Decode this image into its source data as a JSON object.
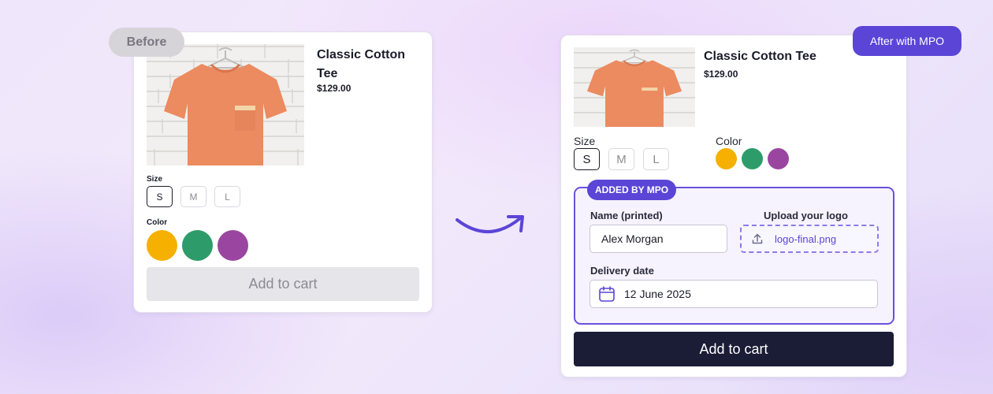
{
  "before": {
    "badge": "Before",
    "title": "Classic Cotton Tee",
    "price": "$129.00",
    "size_label": "Size",
    "sizes": [
      "S",
      "M",
      "L"
    ],
    "selected_size": "S",
    "color_label": "Color",
    "colors": [
      "#f5b000",
      "#2e9c6a",
      "#9a46a0"
    ],
    "cart_label": "Add to cart"
  },
  "after": {
    "badge": "After with MPO",
    "title": "Classic Cotton Tee",
    "price": "$129.00",
    "size_label": "Size",
    "sizes": [
      "S",
      "M",
      "L"
    ],
    "selected_size": "S",
    "color_label": "Color",
    "colors": [
      "#f5b000",
      "#2e9c6a",
      "#9a46a0"
    ],
    "mpo_tag": "ADDED BY MPO",
    "name_label": "Name (printed)",
    "name_value": "Alex Morgan",
    "upload_label": "Upload your logo",
    "upload_file": "logo-final.png",
    "delivery_label": "Delivery date",
    "delivery_value": "12 June 2025",
    "cart_label": "Add to cart"
  },
  "icons": {
    "transition": "curved-arrow-icon",
    "upload": "upload-icon",
    "calendar": "calendar-icon"
  },
  "colors": {
    "accent": "#5b45d6",
    "cart_dark": "#1b1c36"
  }
}
